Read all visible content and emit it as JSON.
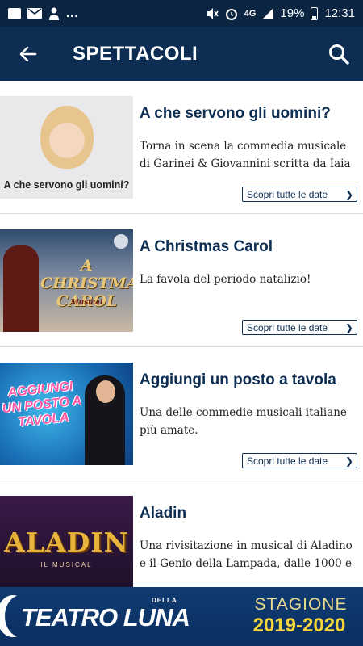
{
  "status_bar": {
    "dots": "...",
    "network": "4G",
    "battery": "19%",
    "time": "12:31",
    "icons": [
      "image-icon",
      "mail-icon",
      "person-icon",
      "mute-icon",
      "alarm-icon",
      "signal-icon",
      "battery-icon"
    ]
  },
  "app_bar": {
    "title": "SPETTACOLI",
    "back_icon": "arrow-left-icon",
    "search_icon": "search-icon"
  },
  "shows": [
    {
      "title": "A che servono gli uomini?",
      "description": "Torna in scena la commedia musicale di Garinei & Giovannini scritta da Iaia",
      "button": "Scopri tutte le date",
      "poster_text": "A che servono gli uomini?"
    },
    {
      "title": "A Christmas Carol",
      "description": "La favola del periodo natalizio!",
      "button": "Scopri tutte le date",
      "poster_text": "A CHRISTMAS CAROL",
      "poster_sub": "Musical"
    },
    {
      "title": "Aggiungi un posto a tavola",
      "description": "Una delle commedie musicali italiane più amate.",
      "button": "Scopri tutte le date",
      "poster_text": "AGGIUNGI UN POSTO A TAVOLA"
    },
    {
      "title": "Aladin",
      "description": "Una rivisitazione in musical di Aladino e il Genio della Lampada, dalle 1000 e",
      "poster_text": "ALADIN",
      "poster_sub": "IL MUSICAL"
    }
  ],
  "banner": {
    "logo": "TEATRO LUNA",
    "della": "DELLA",
    "stagione": "STAGIONE",
    "years": "2019-2020"
  },
  "colors": {
    "primary": "#0d2e52",
    "statusbar": "#0a2442",
    "text": "#222222",
    "banner_yellow": "#f4d53a"
  }
}
